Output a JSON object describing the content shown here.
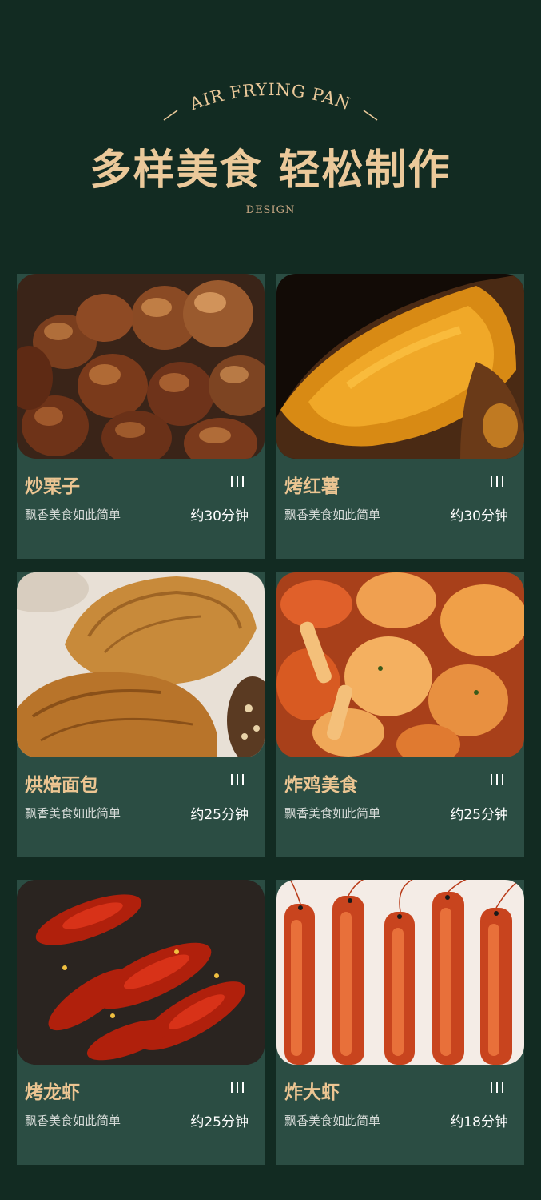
{
  "header": {
    "arc_text": "AIR FRYING PAN",
    "title": "多样美食 轻松制作",
    "subtitle": "DESIGN"
  },
  "cards": [
    {
      "name": "炒栗子",
      "desc": "飘香美食如此简单",
      "time": "约30分钟",
      "photo": "roasted-chestnuts"
    },
    {
      "name": "烤红薯",
      "desc": "飘香美食如此简单",
      "time": "约30分钟",
      "photo": "roasted-sweet-potato"
    },
    {
      "name": "烘焙面包",
      "desc": "飘香美食如此简单",
      "time": "约25分钟",
      "photo": "baked-bread"
    },
    {
      "name": "炸鸡美食",
      "desc": "飘香美食如此简单",
      "time": "约25分钟",
      "photo": "fried-chicken"
    },
    {
      "name": "烤龙虾",
      "desc": "飘香美食如此简单",
      "time": "约25分钟",
      "photo": "roasted-crayfish"
    },
    {
      "name": "炸大虾",
      "desc": "飘香美食如此简单",
      "time": "约18分钟",
      "photo": "fried-shrimp"
    }
  ],
  "colors": {
    "background": "#122b22",
    "card": "#2b4d43",
    "gold": "#ecc592"
  }
}
